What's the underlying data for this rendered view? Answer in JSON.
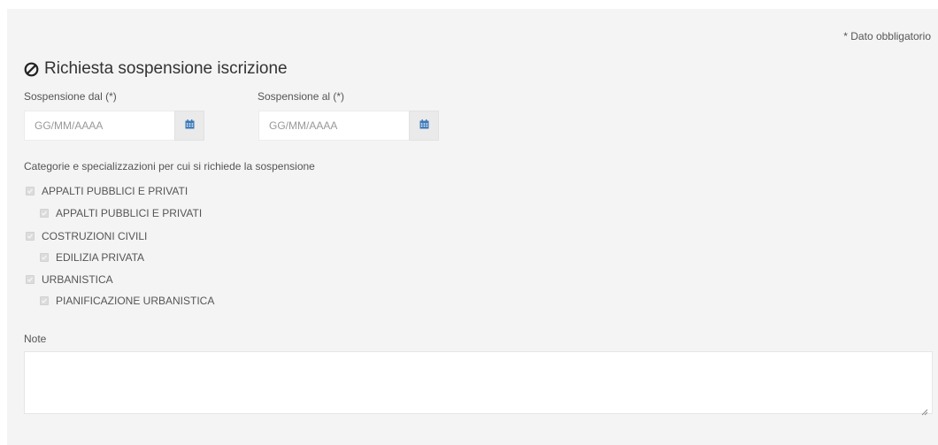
{
  "form": {
    "required_note": "* Dato obbligatorio",
    "title": "Richiesta sospensione iscrizione",
    "title_icon": "ban-icon",
    "from_label": "Sospensione dal (*)",
    "from_placeholder": "GG/MM/AAAA",
    "to_label": "Sospensione al (*)",
    "to_placeholder": "GG/MM/AAAA",
    "calendar_icon": "calendar-icon",
    "categories_label": "Categorie e specializzazioni per cui si richiede la sospensione",
    "categories": [
      {
        "label": "APPALTI PUBBLICI E PRIVATI",
        "checked": true,
        "child": {
          "label": "APPALTI PUBBLICI E PRIVATI",
          "checked": true
        }
      },
      {
        "label": "COSTRUZIONI CIVILI",
        "checked": true,
        "child": {
          "label": "EDILIZIA PRIVATA",
          "checked": true
        }
      },
      {
        "label": "URBANISTICA",
        "checked": true,
        "child": {
          "label": "PIANIFICAZIONE URBANISTICA",
          "checked": true
        }
      }
    ],
    "notes_label": "Note",
    "notes_value": ""
  },
  "colors": {
    "panel_bg": "#f4f4f4",
    "calendar_icon": "#3d79b8",
    "checkbox_disabled": "#dcdcdc"
  }
}
